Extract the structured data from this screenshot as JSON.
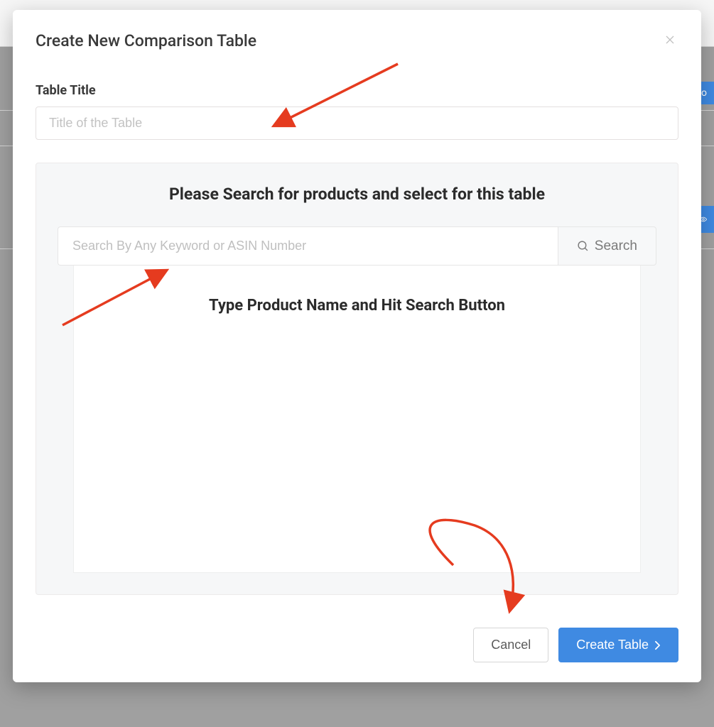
{
  "modal": {
    "title": "Create New Comparison Table",
    "titleField": {
      "label": "Table Title",
      "placeholder": "Title of the Table",
      "value": ""
    },
    "searchPanel": {
      "heading": "Please Search for products and select for this table",
      "input": {
        "placeholder": "Search By Any Keyword or ASIN Number",
        "value": ""
      },
      "searchButtonLabel": "Search",
      "resultsPrompt": "Type Product Name and Hit Search Button"
    },
    "footer": {
      "cancelLabel": "Cancel",
      "submitLabel": "Create Table"
    }
  },
  "background": {
    "topButtonFragment": "Co"
  },
  "colors": {
    "primary": "#3f8ae2",
    "annotationArrow": "#e53b1f"
  }
}
